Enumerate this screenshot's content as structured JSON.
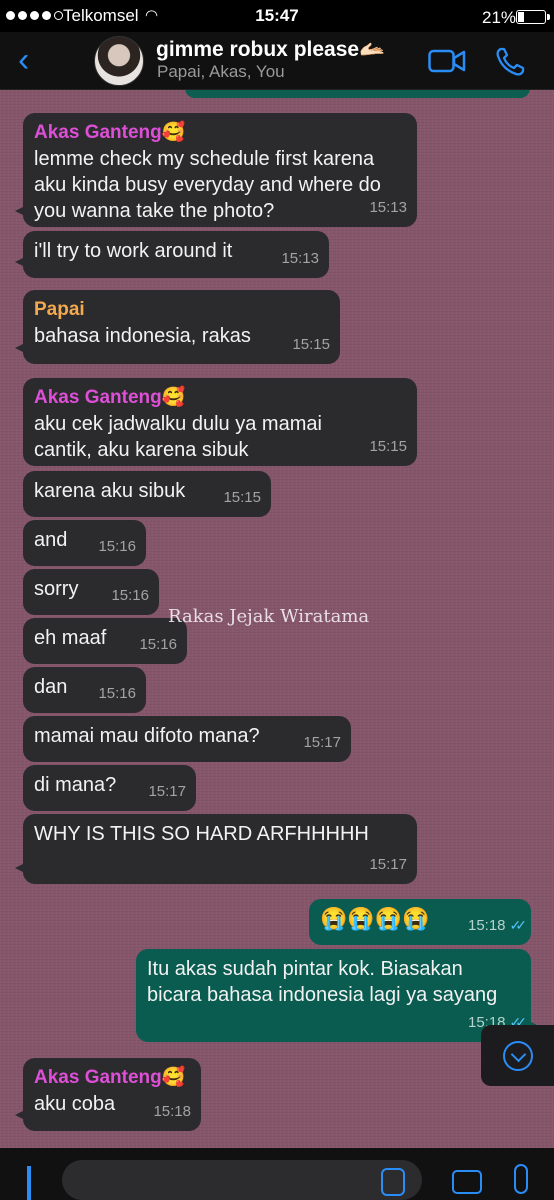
{
  "status_bar": {
    "carrier": "Telkomsel",
    "time": "15:47",
    "battery": "21%"
  },
  "header": {
    "title": "gimme robux please🫴🏻",
    "subtitle": "Papai, Akas, You"
  },
  "watermark": "Rakas Jejak Wiratama",
  "messages": [
    {
      "sender": "Akas Ganteng🥰",
      "text": "lemme check my schedule first karena aku kinda busy everyday and where do you wanna take the photo?",
      "time": "15:13"
    },
    {
      "text": "i'll try to work around it",
      "time": "15:13"
    },
    {
      "sender": "Papai",
      "text": "bahasa indonesia, rakas",
      "time": "15:15"
    },
    {
      "sender": "Akas Ganteng🥰",
      "text": "aku cek jadwalku dulu ya mamai cantik, aku karena sibuk",
      "time": "15:15"
    },
    {
      "text": "karena aku sibuk",
      "time": "15:15"
    },
    {
      "text": "and",
      "time": "15:16"
    },
    {
      "text": "sorry",
      "time": "15:16"
    },
    {
      "text": "eh maaf",
      "time": "15:16"
    },
    {
      "text": "dan",
      "time": "15:16"
    },
    {
      "text": "mamai mau difoto mana?",
      "time": "15:17"
    },
    {
      "text": "di mana?",
      "time": "15:17"
    },
    {
      "text": "WHY IS THIS SO HARD ARFHHHHH",
      "time": "15:17"
    },
    {
      "text": "😭😭😭😭",
      "time": "15:18",
      "outgoing": true
    },
    {
      "text": "Itu akas sudah pintar kok. Biasakan bicara bahasa indonesia lagi ya sayang",
      "time": "15:18",
      "outgoing": true
    },
    {
      "sender": "Akas Ganteng🥰",
      "text": "aku coba",
      "time": "15:18"
    }
  ],
  "colors": {
    "akas_name": "#dc4fd6",
    "papai_name": "#f3a94f",
    "incoming_bubble": "#2b2b2d",
    "outgoing_bubble": "#0a5c50",
    "accent": "#2a8df5",
    "read_ticks": "#4fc3f7"
  },
  "icons": [
    "back-chevron-icon",
    "video-call-icon",
    "phone-icon",
    "scroll-down-icon",
    "plus-icon",
    "sticker-icon",
    "camera-icon",
    "mic-icon"
  ]
}
